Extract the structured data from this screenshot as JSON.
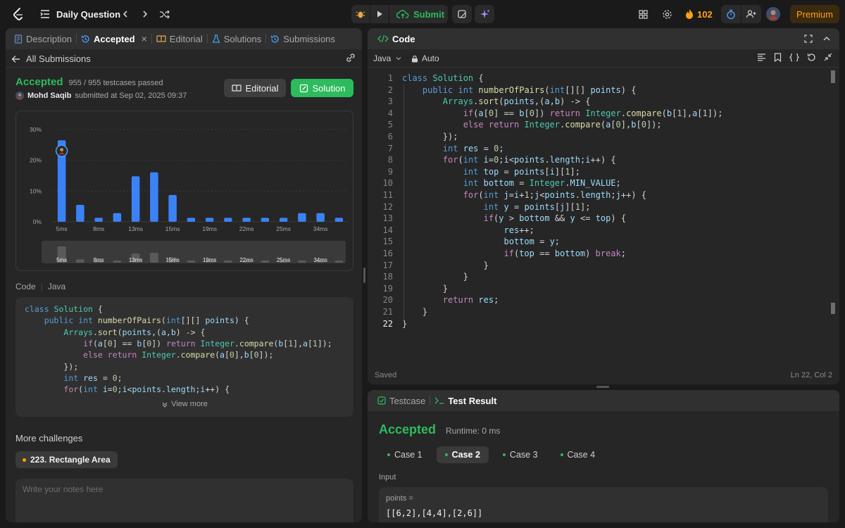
{
  "topbar": {
    "problem_list_label": "Daily Question",
    "submit_label": "Submit",
    "streak_count": "102",
    "premium_label": "Premium"
  },
  "left_tabs": {
    "description": "Description",
    "accepted": "Accepted",
    "editorial": "Editorial",
    "solutions": "Solutions",
    "submissions": "Submissions"
  },
  "submission": {
    "back_label": "All Submissions",
    "status": "Accepted",
    "testcases": "955 / 955 testcases passed",
    "user": "Mohd Saqib",
    "submitted_at": "submitted at Sep 02, 2025 09:37",
    "editorial_button": "Editorial",
    "solution_button": "Solution"
  },
  "chart_data": {
    "type": "bar",
    "yticks": [
      "30%",
      "20%",
      "10%",
      "0%"
    ],
    "xticks": [
      "5ms",
      "8ms",
      "13ms",
      "15ms",
      "19ms",
      "22ms",
      "25ms",
      "34ms"
    ],
    "ylim": [
      0,
      30
    ],
    "values": [
      26.5,
      5.5,
      1.3,
      2.8,
      14.8,
      16.1,
      8.7,
      1.3,
      1.3,
      1.3,
      1.3,
      1.3,
      1.3,
      2.8,
      2.8,
      1.3
    ],
    "highlight_index": 0,
    "bar_color": "#3b82f6"
  },
  "code_section": {
    "label": "Code",
    "language": "Java",
    "view_more": "View more",
    "preview_lines": [
      "class Solution {",
      "    public int numberOfPairs(int[][] points) {",
      "        Arrays.sort(points,(a,b) -> {",
      "            if(a[0] == b[0]) return Integer.compare(b[1],a[1]);",
      "            else return Integer.compare(a[0],b[0]);",
      "        });",
      "        int res = 0;",
      "        for(int i=0;i<points.length;i++) {"
    ]
  },
  "more_challenges": {
    "label": "More challenges",
    "item": "223. Rectangle Area"
  },
  "notes": {
    "placeholder": "Write your notes here"
  },
  "editor": {
    "title": "Code",
    "language": "Java",
    "auto_label": "Auto",
    "saved_label": "Saved",
    "cursor_pos": "Ln 22, Col 2",
    "line_numbers": [
      "1",
      "2",
      "3",
      "4",
      "5",
      "6",
      "7",
      "8",
      "9",
      "10",
      "11",
      "12",
      "13",
      "14",
      "15",
      "16",
      "17",
      "18",
      "19",
      "20",
      "21",
      "22"
    ]
  },
  "test_panel": {
    "testcase_tab": "Testcase",
    "result_tab": "Test Result",
    "status": "Accepted",
    "runtime": "Runtime: 0 ms",
    "cases": [
      "Case 1",
      "Case 2",
      "Case 3",
      "Case 4"
    ],
    "input_label": "Input",
    "var_label": "points =",
    "var_value": "[[6,2],[4,4],[2,6]]"
  },
  "colors": {
    "accent_green": "#2cbb5d",
    "bar_blue": "#3b82f6",
    "streak_orange": "#ffa116",
    "premium_text": "#ffa116"
  }
}
